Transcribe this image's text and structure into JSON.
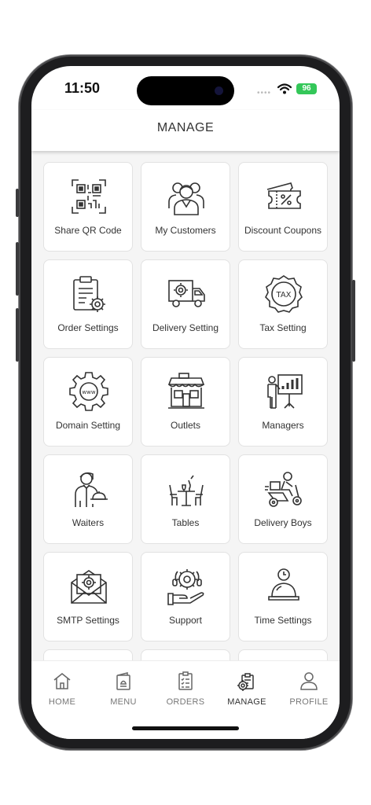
{
  "status_bar": {
    "time": "11:50",
    "battery": "96"
  },
  "header": {
    "title": "MANAGE"
  },
  "tiles": [
    {
      "label": "Share QR Code",
      "icon": "qr-code-icon"
    },
    {
      "label": "My Customers",
      "icon": "customers-icon"
    },
    {
      "label": "Discount Coupons",
      "icon": "coupon-icon"
    },
    {
      "label": "Order Settings",
      "icon": "clipboard-gear-icon"
    },
    {
      "label": "Delivery Setting",
      "icon": "delivery-truck-icon"
    },
    {
      "label": "Tax Setting",
      "icon": "tax-badge-icon"
    },
    {
      "label": "Domain Setting",
      "icon": "gear-www-icon"
    },
    {
      "label": "Outlets",
      "icon": "storefront-icon"
    },
    {
      "label": "Managers",
      "icon": "presentation-icon"
    },
    {
      "label": "Waiters",
      "icon": "waiter-icon"
    },
    {
      "label": "Tables",
      "icon": "table-chairs-icon"
    },
    {
      "label": "Delivery Boys",
      "icon": "scooter-rider-icon"
    },
    {
      "label": "SMTP Settings",
      "icon": "mail-gear-icon"
    },
    {
      "label": "Support",
      "icon": "support-hand-icon"
    },
    {
      "label": "Time Settings",
      "icon": "cloche-clock-icon"
    }
  ],
  "tabs": [
    {
      "label": "HOME",
      "icon": "home-icon"
    },
    {
      "label": "MENU",
      "icon": "menu-book-icon"
    },
    {
      "label": "ORDERS",
      "icon": "orders-clipboard-icon"
    },
    {
      "label": "MANAGE",
      "icon": "manage-icon",
      "active": true
    },
    {
      "label": "PROFILE",
      "icon": "profile-icon"
    }
  ]
}
